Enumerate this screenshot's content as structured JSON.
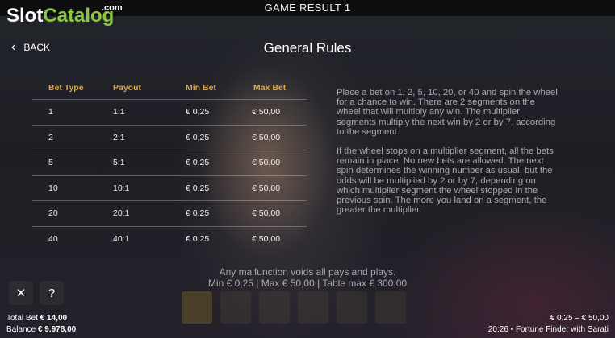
{
  "window": {
    "title": "GAME RESULT 1"
  },
  "logo": {
    "part1": "Slot",
    "part2": "Catalog",
    "suffix": ".com"
  },
  "nav": {
    "back_label": "BACK",
    "back_icon": "chevron-left-icon"
  },
  "page": {
    "heading": "General Rules"
  },
  "table": {
    "headers": [
      "Bet Type",
      "Payout",
      "Min Bet",
      "Max Bet"
    ],
    "rows": [
      [
        "1",
        "1:1",
        "€ 0,25",
        "€ 50,00"
      ],
      [
        "2",
        "2:1",
        "€ 0,25",
        "€ 50,00"
      ],
      [
        "5",
        "5:1",
        "€ 0,25",
        "€ 50,00"
      ],
      [
        "10",
        "10:1",
        "€ 0,25",
        "€ 50,00"
      ],
      [
        "20",
        "20:1",
        "€ 0,25",
        "€ 50,00"
      ],
      [
        "40",
        "40:1",
        "€ 0,25",
        "€ 50,00"
      ]
    ]
  },
  "description": {
    "p1": "Place a bet on 1, 2, 5, 10, 20, or 40 and spin the wheel for a chance to win. There are 2 segments on the wheel that will multiply any win. The multiplier segments multiply the next win by 2 or by 7, according to the segment.",
    "p2": "If the wheel stops on a multiplier segment, all the bets remain in place. No new bets are allowed. The next spin determines the winning number as usual, but the odds will be multiplied by 2 or by 7, depending on which multiplier segment the wheel stopped in the previous spin. The more you land on a segment, the greater the multiplier."
  },
  "footer": {
    "malfunction": "Any malfunction voids all pays and plays.",
    "limits": "Min € 0,25 | Max € 50,00 | Table max € 300,00"
  },
  "controls": {
    "close_icon": "close-icon",
    "close_glyph": "✕",
    "help_icon": "help-icon",
    "help_glyph": "?"
  },
  "status": {
    "total_bet_label": "Total Bet",
    "total_bet_value": "€ 14,00",
    "balance_label": "Balance",
    "balance_value": "€ 9.978,00",
    "bet_range": "€ 0,25 – € 50,00",
    "time_game": "20:26 • Fortune Finder with Sarati"
  },
  "colors": {
    "header_accent": "#e0a53a",
    "logo_green": "#8cc63f"
  }
}
